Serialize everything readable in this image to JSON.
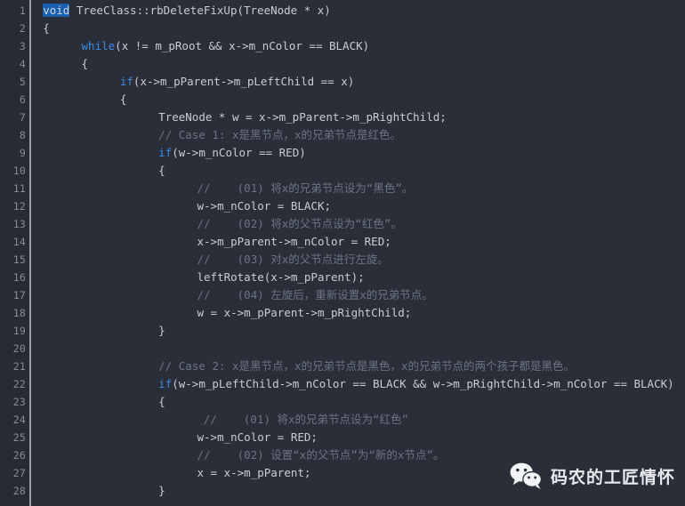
{
  "editor": {
    "language": "cpp",
    "theme_colors": {
      "background": "#2a2e39",
      "gutter_background": "#272b34",
      "gutter_rule": "#9aa2ad",
      "line_number": "#848d97",
      "foreground": "#c8ccd4",
      "keyword": "#3d8ae5",
      "keyword_selected_background": "#1b5fb0",
      "comment": "#6b7480"
    },
    "first_line_number": 1,
    "last_line_number": 28,
    "line_numbers": [
      1,
      2,
      3,
      4,
      5,
      6,
      7,
      8,
      9,
      10,
      11,
      12,
      13,
      14,
      15,
      16,
      17,
      18,
      19,
      20,
      21,
      22,
      23,
      24,
      25,
      26,
      27,
      28
    ],
    "lines": [
      {
        "n": 1,
        "indent": 1,
        "segments": [
          {
            "t": "void",
            "k": "kw-sel"
          },
          {
            "t": " TreeClass::rbDeleteFixUp(TreeNode * x)",
            "k": "txt"
          }
        ]
      },
      {
        "n": 2,
        "indent": 1,
        "segments": [
          {
            "t": "{",
            "k": "txt"
          }
        ]
      },
      {
        "n": 3,
        "indent": 7,
        "segments": [
          {
            "t": "while",
            "k": "kw"
          },
          {
            "t": "(x != m_pRoot && x->m_nColor == BLACK)",
            "k": "txt"
          }
        ]
      },
      {
        "n": 4,
        "indent": 7,
        "segments": [
          {
            "t": "{",
            "k": "txt"
          }
        ]
      },
      {
        "n": 5,
        "indent": 13,
        "segments": [
          {
            "t": "if",
            "k": "kw"
          },
          {
            "t": "(x->m_pParent->m_pLeftChild == x)",
            "k": "txt"
          }
        ]
      },
      {
        "n": 6,
        "indent": 13,
        "segments": [
          {
            "t": "{",
            "k": "txt"
          }
        ]
      },
      {
        "n": 7,
        "indent": 19,
        "segments": [
          {
            "t": "TreeNode * w = x->m_pParent->m_pRightChild;",
            "k": "txt"
          }
        ]
      },
      {
        "n": 8,
        "indent": 19,
        "segments": [
          {
            "t": "// Case 1: x是黑节点，x的兄弟节点是红色。",
            "k": "cmt"
          }
        ]
      },
      {
        "n": 9,
        "indent": 19,
        "segments": [
          {
            "t": "if",
            "k": "kw"
          },
          {
            "t": "(w->m_nColor == RED)",
            "k": "txt"
          }
        ]
      },
      {
        "n": 10,
        "indent": 19,
        "segments": [
          {
            "t": "{",
            "k": "txt"
          }
        ]
      },
      {
        "n": 11,
        "indent": 25,
        "segments": [
          {
            "t": "//    (01) 将x的兄弟节点设为“黑色”。",
            "k": "cmt"
          }
        ]
      },
      {
        "n": 12,
        "indent": 25,
        "segments": [
          {
            "t": "w->m_nColor = BLACK;",
            "k": "txt"
          }
        ]
      },
      {
        "n": 13,
        "indent": 25,
        "segments": [
          {
            "t": "//    (02) 将x的父节点设为“红色”。",
            "k": "cmt"
          }
        ]
      },
      {
        "n": 14,
        "indent": 25,
        "segments": [
          {
            "t": "x->m_pParent->m_nColor = RED;",
            "k": "txt"
          }
        ]
      },
      {
        "n": 15,
        "indent": 25,
        "segments": [
          {
            "t": "//    (03) 对x的父节点进行左旋。",
            "k": "cmt"
          }
        ]
      },
      {
        "n": 16,
        "indent": 25,
        "segments": [
          {
            "t": "leftRotate(x->m_pParent);",
            "k": "txt"
          }
        ]
      },
      {
        "n": 17,
        "indent": 25,
        "segments": [
          {
            "t": "//    (04) 左旋后，重新设置x的兄弟节点。",
            "k": "cmt"
          }
        ]
      },
      {
        "n": 18,
        "indent": 25,
        "segments": [
          {
            "t": "w = x->m_pParent->m_pRightChild;",
            "k": "txt"
          }
        ]
      },
      {
        "n": 19,
        "indent": 19,
        "segments": [
          {
            "t": "}",
            "k": "txt"
          }
        ]
      },
      {
        "n": 20,
        "indent": 19,
        "segments": [
          {
            "t": "",
            "k": "txt"
          }
        ]
      },
      {
        "n": 21,
        "indent": 19,
        "segments": [
          {
            "t": "// Case 2: x是黑节点，x的兄弟节点是黑色，x的兄弟节点的两个孩子都是黑色。",
            "k": "cmt"
          }
        ]
      },
      {
        "n": 22,
        "indent": 19,
        "segments": [
          {
            "t": "if",
            "k": "kw"
          },
          {
            "t": "(w->m_pLeftChild->m_nColor == BLACK && w->m_pRightChild->m_nColor == BLACK)",
            "k": "txt"
          }
        ]
      },
      {
        "n": 23,
        "indent": 19,
        "segments": [
          {
            "t": "{",
            "k": "txt"
          }
        ]
      },
      {
        "n": 24,
        "indent": 26,
        "segments": [
          {
            "t": "//    (01) 将x的兄弟节点设为“红色”",
            "k": "cmt"
          }
        ]
      },
      {
        "n": 25,
        "indent": 25,
        "segments": [
          {
            "t": "w->m_nColor = RED;",
            "k": "txt"
          }
        ]
      },
      {
        "n": 26,
        "indent": 25,
        "segments": [
          {
            "t": "//    (02) 设置“x的父节点”为“新的x节点”。",
            "k": "cmt"
          }
        ]
      },
      {
        "n": 27,
        "indent": 25,
        "segments": [
          {
            "t": "x = x->m_pParent;",
            "k": "txt"
          }
        ]
      },
      {
        "n": 28,
        "indent": 19,
        "segments": [
          {
            "t": "}",
            "k": "txt"
          }
        ]
      }
    ]
  },
  "watermark": {
    "icon": "wechat-icon",
    "text": "码农的工匠情怀"
  }
}
